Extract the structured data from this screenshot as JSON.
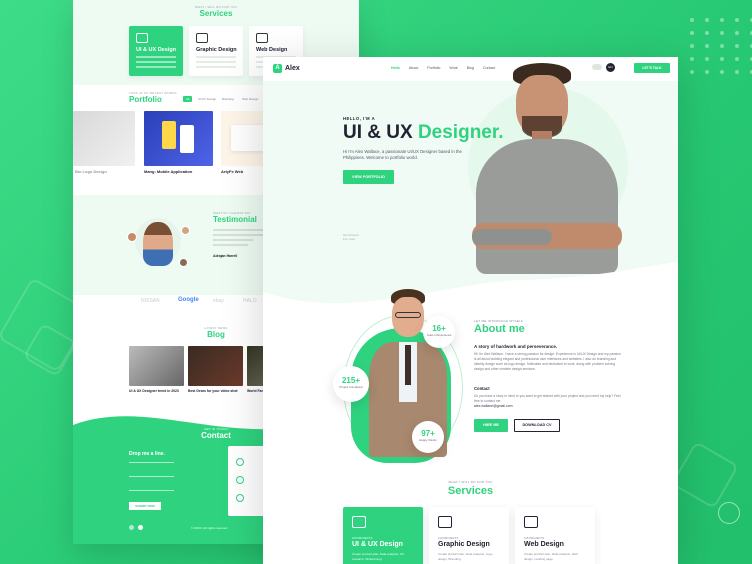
{
  "back_page": {
    "services_tag": "WHAT I WILL DO FOR YOU",
    "services_title": "Services",
    "services": [
      {
        "label": "UI & UX Design",
        "active": true
      },
      {
        "label": "Graphic Design",
        "active": false
      },
      {
        "label": "Web Design",
        "active": false
      }
    ],
    "portfolio_tag": "LOOK AT MY RECENT WORKS",
    "portfolio_title": "Portfolio",
    "portfolio_tabs": [
      "All",
      "UI/UX Design",
      "Branding",
      "Web Design"
    ],
    "portfolio_items": [
      {
        "title": "Bio Logo Design"
      },
      {
        "title": "Mang: Mobile Application"
      },
      {
        "title": "ArtyFe Web"
      }
    ],
    "testimonial_tag": "WHAT MY CLIENTS SAY",
    "testimonial_title": "Testimonial",
    "testimonial_name": "Adrajan Harrell",
    "client_logos": [
      "NISSAN",
      "Google",
      "ebay",
      "HALO"
    ],
    "blog_tag": "LATEST NEWS",
    "blog_title": "Blog",
    "blog_posts": [
      {
        "title": "UI & UX Designer trend in 2023"
      },
      {
        "title": "Best Gears for your video shot"
      },
      {
        "title": "World Famo"
      }
    ],
    "contact_tag": "GET IN TOUCH",
    "contact_title": "Contact",
    "contact_heading": "Drop me a line.",
    "submit_label": "SUBMIT NOW",
    "footer_copy": "© 2023 | All rights reserved"
  },
  "front_page": {
    "brand": "Alex",
    "brand_letter": "A",
    "nav": [
      "Hello",
      "About",
      "Portfolio",
      "Work",
      "Blog",
      "Contact"
    ],
    "nav_active": "Hello",
    "lang_badge": "EN",
    "cta_label": "LET'S TALK",
    "hello": "HELLO, I'M A",
    "hero_title_plain": "UI & UX ",
    "hero_title_accent": "Designer.",
    "hero_desc": "Hi I'm Alex Wallace, a passionate UI/UX Designer based in the Philippines. Welcome to portfolio world.",
    "hero_button": "VIEW PORTFOLIO",
    "scroll_text": "Scroll Down",
    "scroll_sub": "For more",
    "about_tag": "LET ME INTRODUCE MYSELF",
    "about_title": "About me",
    "story": "A story of hardwork and perseverance.",
    "about_para": "Hi! I'm Alex Wallace. I have a strong passion for design. Experience in UI/UX Design and my passion is all about building elegant and professional user interfaces and websites. I also do branding and identity design such as logo design. Motivated and dedicated to work, along with problem solving design and other creative design services.",
    "contact_label": "Contact",
    "contact_para": "Do you have a story in mind or you want to get started with your project and you need my help? Feel free to contact me.",
    "email": "alex.wallace@gmail.com",
    "hire_button": "HIRE ME",
    "download_button": "DOWNLOAD CV",
    "stats": [
      {
        "value": "16+",
        "label": "Years of Experience"
      },
      {
        "value": "215+",
        "label": "Project Completed"
      },
      {
        "value": "97+",
        "label": "Happy Clients"
      }
    ],
    "services_tag": "WHAT I WILL DO FOR YOU",
    "services_title": "Services",
    "services": [
      {
        "tag": "100 PROJECTS",
        "name": "UI & UX Design",
        "desc": "Create product plan. Data analysis, UX research, Wireframing.",
        "active": true
      },
      {
        "tag": "120 PROJECTS",
        "name": "Graphic Design",
        "desc": "Create product plan. Data analysis, Logo design, Branding.",
        "active": false
      },
      {
        "tag": "115 PROJECTS",
        "name": "Web Design",
        "desc": "Create product plan. Data analysis, Web design, Landing page.",
        "active": false
      }
    ]
  },
  "colors": {
    "accent": "#2fd37f",
    "dark": "#223322",
    "background": "#2fd37f"
  }
}
